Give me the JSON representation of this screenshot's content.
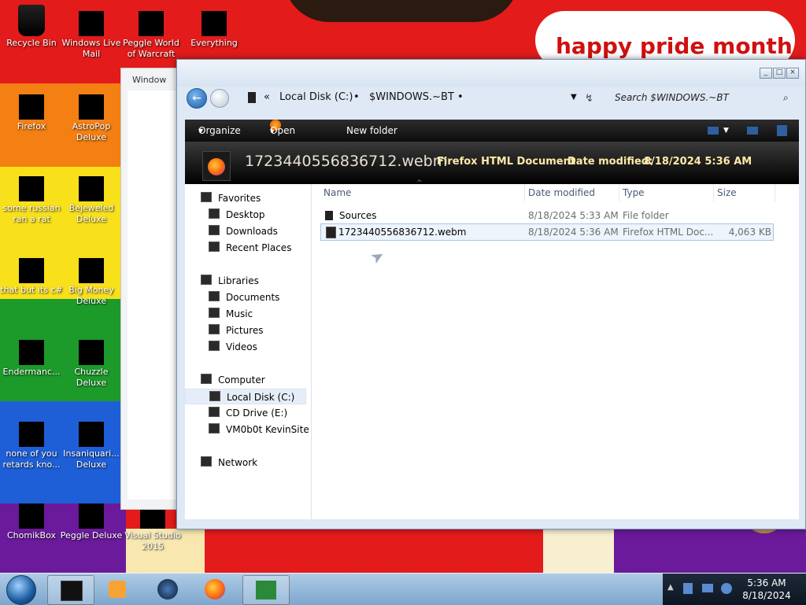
{
  "desktop": {
    "banner": "happy pride month",
    "icons": [
      {
        "label": "Recycle Bin"
      },
      {
        "label": "Windows Live Mail"
      },
      {
        "label": "Peggle World of Warcraft"
      },
      {
        "label": "Everything"
      },
      {
        "label": "Firefox"
      },
      {
        "label": "AstroPop Deluxe"
      },
      {
        "label": "some russian ran a rat"
      },
      {
        "label": "Bejeweled Deluxe"
      },
      {
        "label": "that but its c#"
      },
      {
        "label": "Big Money Deluxe"
      },
      {
        "label": "Endermanc..."
      },
      {
        "label": "Chuzzle Deluxe"
      },
      {
        "label": "none of you retards kno..."
      },
      {
        "label": "Insaniquari... Deluxe"
      },
      {
        "label": "ChomikBox"
      },
      {
        "label": "Peggle Deluxe"
      },
      {
        "label": "Visual Studio 2015"
      }
    ],
    "bg_window_title": "Window"
  },
  "explorer": {
    "address": {
      "overflow": "«",
      "segments": [
        "Local Disk (C:)",
        "$WINDOWS.~BT"
      ],
      "separator": "•"
    },
    "search_placeholder": "Search $WINDOWS.~BT",
    "toolbar": {
      "organize": "Organize",
      "open": "Open",
      "new_folder": "New folder"
    },
    "details": {
      "name": "1723440556836712.webm",
      "type": "Firefox HTML Document",
      "modified_label": "Date modified:",
      "modified_value": "8/18/2024 5:36 AM"
    },
    "nav": {
      "favorites": "Favorites",
      "desktop": "Desktop",
      "downloads": "Downloads",
      "recent": "Recent Places",
      "libraries": "Libraries",
      "documents": "Documents",
      "music": "Music",
      "pictures": "Pictures",
      "videos": "Videos",
      "computer": "Computer",
      "local_disk": "Local Disk (C:)",
      "cd_drive": "CD Drive (E:)",
      "vm_site": "VM0b0t KevinSite",
      "network": "Network"
    },
    "columns": {
      "name": "Name",
      "modified": "Date modified",
      "type": "Type",
      "size": "Size"
    },
    "files": [
      {
        "name": "Sources",
        "modified": "8/18/2024 5:33 AM",
        "type": "File folder",
        "size": ""
      },
      {
        "name": "1723440556836712.webm",
        "modified": "8/18/2024 5:36 AM",
        "type": "Firefox HTML Doc...",
        "size": "4,063 KB"
      }
    ]
  },
  "taskbar": {
    "time": "5:36 AM",
    "date": "8/18/2024"
  },
  "colors": {
    "red": "#e31b1b",
    "orange": "#f47f12",
    "yellow": "#f8e01a",
    "green": "#1c9a2a",
    "blue": "#1e5fd8",
    "purple": "#6a1a9a"
  }
}
